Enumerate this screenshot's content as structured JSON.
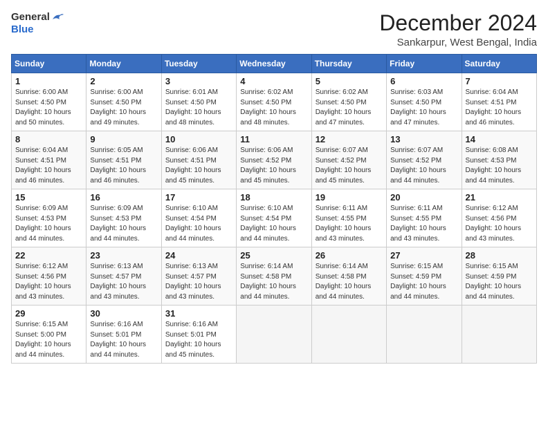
{
  "logo": {
    "general": "General",
    "blue": "Blue"
  },
  "title": "December 2024",
  "location": "Sankarpur, West Bengal, India",
  "weekdays": [
    "Sunday",
    "Monday",
    "Tuesday",
    "Wednesday",
    "Thursday",
    "Friday",
    "Saturday"
  ],
  "weeks": [
    [
      {
        "day": 1,
        "info": "Sunrise: 6:00 AM\nSunset: 4:50 PM\nDaylight: 10 hours\nand 50 minutes."
      },
      {
        "day": 2,
        "info": "Sunrise: 6:00 AM\nSunset: 4:50 PM\nDaylight: 10 hours\nand 49 minutes."
      },
      {
        "day": 3,
        "info": "Sunrise: 6:01 AM\nSunset: 4:50 PM\nDaylight: 10 hours\nand 48 minutes."
      },
      {
        "day": 4,
        "info": "Sunrise: 6:02 AM\nSunset: 4:50 PM\nDaylight: 10 hours\nand 48 minutes."
      },
      {
        "day": 5,
        "info": "Sunrise: 6:02 AM\nSunset: 4:50 PM\nDaylight: 10 hours\nand 47 minutes."
      },
      {
        "day": 6,
        "info": "Sunrise: 6:03 AM\nSunset: 4:50 PM\nDaylight: 10 hours\nand 47 minutes."
      },
      {
        "day": 7,
        "info": "Sunrise: 6:04 AM\nSunset: 4:51 PM\nDaylight: 10 hours\nand 46 minutes."
      }
    ],
    [
      {
        "day": 8,
        "info": "Sunrise: 6:04 AM\nSunset: 4:51 PM\nDaylight: 10 hours\nand 46 minutes."
      },
      {
        "day": 9,
        "info": "Sunrise: 6:05 AM\nSunset: 4:51 PM\nDaylight: 10 hours\nand 46 minutes."
      },
      {
        "day": 10,
        "info": "Sunrise: 6:06 AM\nSunset: 4:51 PM\nDaylight: 10 hours\nand 45 minutes."
      },
      {
        "day": 11,
        "info": "Sunrise: 6:06 AM\nSunset: 4:52 PM\nDaylight: 10 hours\nand 45 minutes."
      },
      {
        "day": 12,
        "info": "Sunrise: 6:07 AM\nSunset: 4:52 PM\nDaylight: 10 hours\nand 45 minutes."
      },
      {
        "day": 13,
        "info": "Sunrise: 6:07 AM\nSunset: 4:52 PM\nDaylight: 10 hours\nand 44 minutes."
      },
      {
        "day": 14,
        "info": "Sunrise: 6:08 AM\nSunset: 4:53 PM\nDaylight: 10 hours\nand 44 minutes."
      }
    ],
    [
      {
        "day": 15,
        "info": "Sunrise: 6:09 AM\nSunset: 4:53 PM\nDaylight: 10 hours\nand 44 minutes."
      },
      {
        "day": 16,
        "info": "Sunrise: 6:09 AM\nSunset: 4:53 PM\nDaylight: 10 hours\nand 44 minutes."
      },
      {
        "day": 17,
        "info": "Sunrise: 6:10 AM\nSunset: 4:54 PM\nDaylight: 10 hours\nand 44 minutes."
      },
      {
        "day": 18,
        "info": "Sunrise: 6:10 AM\nSunset: 4:54 PM\nDaylight: 10 hours\nand 44 minutes."
      },
      {
        "day": 19,
        "info": "Sunrise: 6:11 AM\nSunset: 4:55 PM\nDaylight: 10 hours\nand 43 minutes."
      },
      {
        "day": 20,
        "info": "Sunrise: 6:11 AM\nSunset: 4:55 PM\nDaylight: 10 hours\nand 43 minutes."
      },
      {
        "day": 21,
        "info": "Sunrise: 6:12 AM\nSunset: 4:56 PM\nDaylight: 10 hours\nand 43 minutes."
      }
    ],
    [
      {
        "day": 22,
        "info": "Sunrise: 6:12 AM\nSunset: 4:56 PM\nDaylight: 10 hours\nand 43 minutes."
      },
      {
        "day": 23,
        "info": "Sunrise: 6:13 AM\nSunset: 4:57 PM\nDaylight: 10 hours\nand 43 minutes."
      },
      {
        "day": 24,
        "info": "Sunrise: 6:13 AM\nSunset: 4:57 PM\nDaylight: 10 hours\nand 43 minutes."
      },
      {
        "day": 25,
        "info": "Sunrise: 6:14 AM\nSunset: 4:58 PM\nDaylight: 10 hours\nand 44 minutes."
      },
      {
        "day": 26,
        "info": "Sunrise: 6:14 AM\nSunset: 4:58 PM\nDaylight: 10 hours\nand 44 minutes."
      },
      {
        "day": 27,
        "info": "Sunrise: 6:15 AM\nSunset: 4:59 PM\nDaylight: 10 hours\nand 44 minutes."
      },
      {
        "day": 28,
        "info": "Sunrise: 6:15 AM\nSunset: 4:59 PM\nDaylight: 10 hours\nand 44 minutes."
      }
    ],
    [
      {
        "day": 29,
        "info": "Sunrise: 6:15 AM\nSunset: 5:00 PM\nDaylight: 10 hours\nand 44 minutes."
      },
      {
        "day": 30,
        "info": "Sunrise: 6:16 AM\nSunset: 5:01 PM\nDaylight: 10 hours\nand 44 minutes."
      },
      {
        "day": 31,
        "info": "Sunrise: 6:16 AM\nSunset: 5:01 PM\nDaylight: 10 hours\nand 45 minutes."
      },
      null,
      null,
      null,
      null
    ]
  ]
}
